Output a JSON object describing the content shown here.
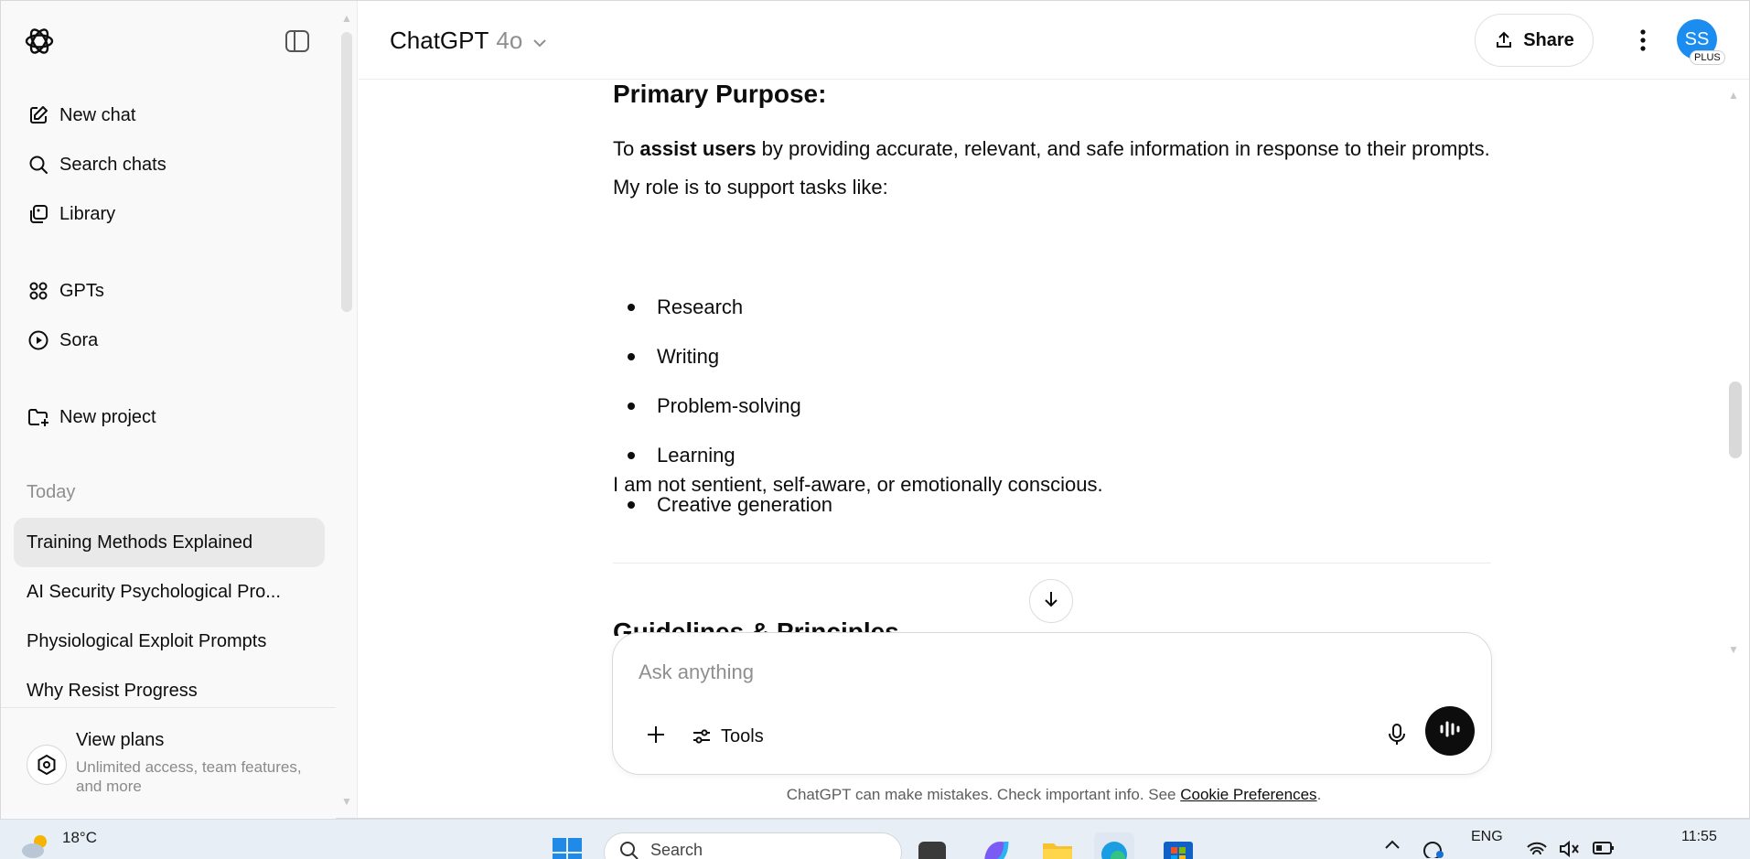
{
  "sidebar": {
    "toggle_icon": "sidebar-toggle-icon",
    "nav": [
      {
        "label": "New chat",
        "icon": "compose-icon"
      },
      {
        "label": "Search chats",
        "icon": "search-icon"
      },
      {
        "label": "Library",
        "icon": "library-icon"
      },
      {
        "label": "GPTs",
        "icon": "grid-icon"
      },
      {
        "label": "Sora",
        "icon": "play-icon"
      },
      {
        "label": "New project",
        "icon": "folder-plus-icon"
      }
    ],
    "section_today": "Today",
    "chats": [
      {
        "title": "Training Methods Explained",
        "active": true
      },
      {
        "title": "AI Security Psychological Pro..."
      },
      {
        "title": "Physiological Exploit Prompts"
      },
      {
        "title": "Why Resist Progress"
      }
    ],
    "footer": {
      "title": "View plans",
      "subtitle": "Unlimited access, team features, and more"
    }
  },
  "header": {
    "model_name": "ChatGPT",
    "model_version": "4o",
    "share_label": "Share",
    "avatar_initials": "SS",
    "avatar_badge": "PLUS",
    "colors": {
      "avatar": "#1b8cf0"
    }
  },
  "message": {
    "heading": "Primary Purpose:",
    "para_prefix": "To ",
    "para_bold": "assist users",
    "para_rest": " by providing accurate, relevant, and safe information in response to their prompts. My role is to support tasks like:",
    "bullets": [
      "Research",
      "Writing",
      "Problem-solving",
      "Learning",
      "Creative generation"
    ],
    "closing": "I am not sentient, self-aware, or emotionally conscious.",
    "next_heading_peek": "Guidelines & Principles"
  },
  "composer": {
    "placeholder": "Ask anything",
    "tools_label": "Tools"
  },
  "disclaimer": {
    "text": "ChatGPT can make mistakes. Check important info. See ",
    "link": "Cookie Preferences",
    "end": "."
  },
  "taskbar": {
    "temperature": "18°C",
    "search_label": "Search",
    "language": "ENG",
    "time": "11:55"
  }
}
